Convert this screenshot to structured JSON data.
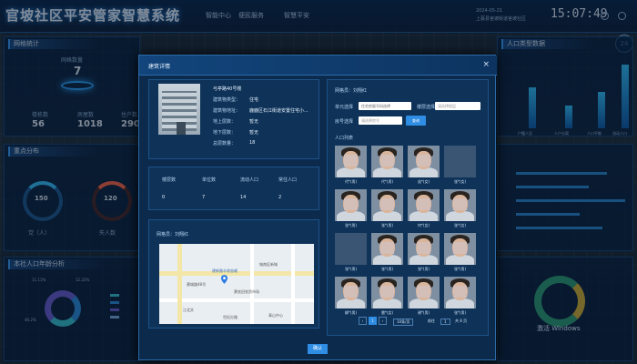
{
  "header": {
    "title": "官坡社区平安管家智慧系统",
    "nav": [
      "智能中心",
      "便民服务",
      "智慧平安"
    ],
    "date": "2024-05-21",
    "address": "上蔡县官坡街道官坡社区",
    "time": "15:07:49",
    "weather_badge": "24"
  },
  "left": {
    "grid_title": "网格统计",
    "grid_count_label": "网格数量",
    "grid_count": "7",
    "stats": [
      {
        "label": "楼栋数",
        "value": "56"
      },
      {
        "label": "房屋数",
        "value": "1018"
      },
      {
        "label": "住户数",
        "value": "290"
      }
    ],
    "dist_title": "重点分布",
    "dist_labels": [
      "党（人）",
      "失人数"
    ],
    "dist_values": [
      "150",
      "120"
    ],
    "age_title": "本社人口年龄分析",
    "age_pcts": [
      "11.11%",
      "12.22%",
      "46.2%"
    ]
  },
  "right": {
    "pop_title": "人口类型数据",
    "pop_cats": [
      "户籍人员",
      "人户分离",
      "人口平衡",
      "流动人口"
    ]
  },
  "modal": {
    "title": "建筑详情",
    "building_name": "弓亭路40号楼",
    "fields": [
      {
        "label": "建筑物类型：",
        "value": "住宅"
      },
      {
        "label": "建筑物地址：",
        "value": "鹿鹿区石江街道安置住宅小..."
      },
      {
        "label": "地上层数：",
        "value": "暂无"
      },
      {
        "label": "地下层数：",
        "value": "暂无"
      },
      {
        "label": "总层数量：",
        "value": "18"
      }
    ],
    "counts_headers": [
      "楼层数",
      "单位数",
      "流动人口",
      "常住人口"
    ],
    "counts_values": [
      "0",
      "7",
      "14",
      "2"
    ],
    "grid_label": "网格员：刘翔红",
    "map_texts": [
      "建新路丰收苗顺",
      "黄城路48号",
      "黄农田农资市场",
      "城南区新城",
      "江北文",
      "青山中心",
      "世纪分路"
    ],
    "right_grid_label": "网格员：刘翔红",
    "filter": {
      "unit_label": "单元选择",
      "unit_value": "住宅房屋号码选择",
      "floor_label": "楼层选择",
      "floor_placeholder": "请选择楼层",
      "house_label": "房号选择",
      "house_placeholder": "请选择房号",
      "search_label": "查询"
    },
    "list_title": "人口列表",
    "people": [
      {
        "name": "代*(男)",
        "empty": false
      },
      {
        "name": "代*(男)",
        "empty": false
      },
      {
        "name": "苗*(女)",
        "empty": false
      },
      {
        "name": "张*(女)",
        "empty": true
      },
      {
        "name": "张*(男)",
        "empty": false
      },
      {
        "name": "张*(男)",
        "empty": false
      },
      {
        "name": "何*(女)",
        "empty": false
      },
      {
        "name": "张*(女)",
        "empty": false
      },
      {
        "name": "张*(男)",
        "empty": true
      },
      {
        "name": "张*(男)",
        "empty": false
      },
      {
        "name": "张*(男)",
        "empty": false
      },
      {
        "name": "张*(男)",
        "empty": false
      },
      {
        "name": "柳*(男)",
        "empty": false
      },
      {
        "name": "雷*(女)",
        "empty": false
      },
      {
        "name": "谢*(男)",
        "empty": false
      },
      {
        "name": "张*(男)",
        "empty": false
      }
    ],
    "pagination": {
      "prev": "‹",
      "page": "1",
      "next": "›",
      "per_page": "10条/页",
      "goto_label": "前往",
      "goto_page": "1",
      "total": "共 8 页"
    },
    "confirm_label": "确认"
  },
  "watermark": "激活 Windows",
  "colors": {
    "accent": "#2f8de4",
    "panel": "#0b2a4c",
    "bg": "#061a33"
  }
}
